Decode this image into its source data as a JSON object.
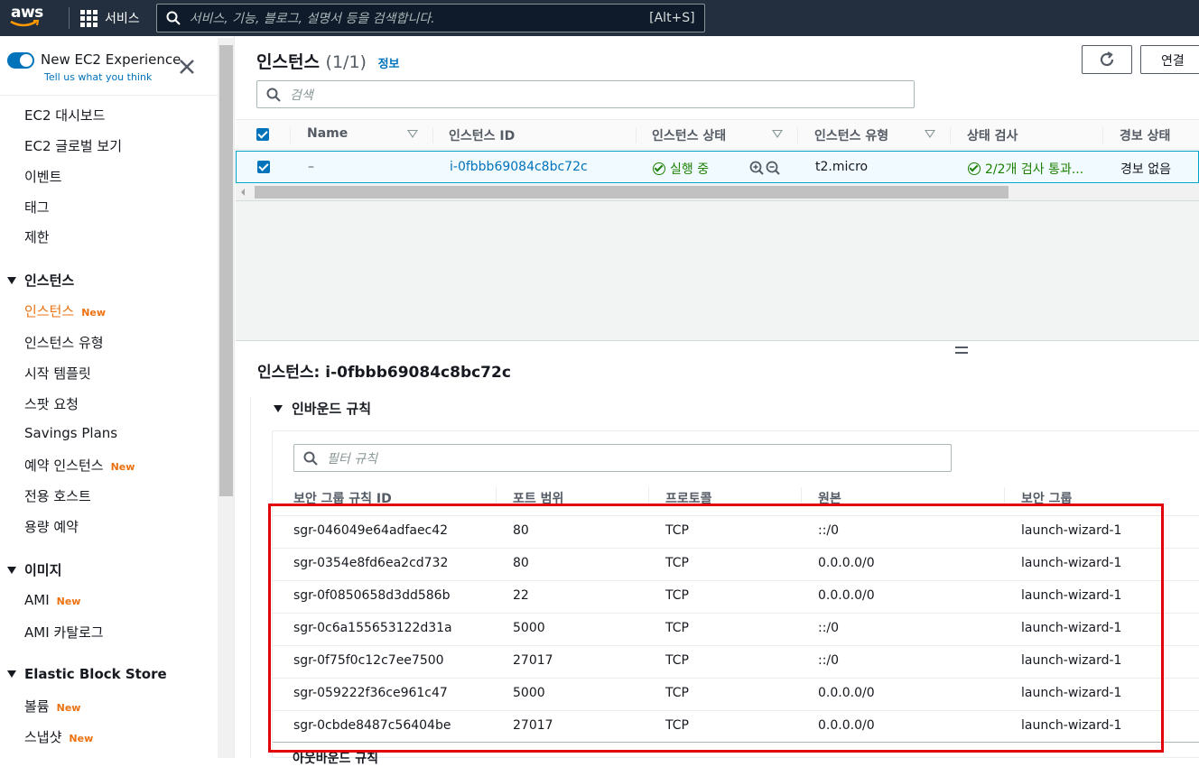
{
  "topbar": {
    "logo_text": "aws",
    "services_label": "서비스",
    "search_placeholder": "서비스, 기능, 블로그, 설명서 등을 검색합니다.",
    "search_shortcut": "[Alt+S]"
  },
  "sidebar": {
    "experience_title": "New EC2 Experience",
    "experience_sub": "Tell us what you think",
    "items": [
      {
        "label": "EC2 대시보드"
      },
      {
        "label": "EC2 글로벌 보기"
      },
      {
        "label": "이벤트"
      },
      {
        "label": "태그"
      },
      {
        "label": "제한"
      }
    ],
    "section_instances": "인스턴스",
    "instances_items": [
      {
        "label": "인스턴스",
        "badge": "New"
      },
      {
        "label": "인스턴스 유형"
      },
      {
        "label": "시작 템플릿"
      },
      {
        "label": "스팟 요청"
      },
      {
        "label": "Savings Plans"
      },
      {
        "label": "예약 인스턴스",
        "badge": "New"
      },
      {
        "label": "전용 호스트"
      },
      {
        "label": "용량 예약"
      }
    ],
    "section_images": "이미지",
    "images_items": [
      {
        "label": "AMI",
        "badge": "New"
      },
      {
        "label": "AMI 카탈로그"
      }
    ],
    "section_ebs": "Elastic Block Store",
    "ebs_items": [
      {
        "label": "볼륨",
        "badge": "New"
      },
      {
        "label": "스냅샷",
        "badge": "New"
      }
    ]
  },
  "main": {
    "title": "인스턴스",
    "count": "(1/1)",
    "info": "정보",
    "connect_label": "연결",
    "search_placeholder": "검색",
    "columns": {
      "name": "Name",
      "instance_id": "인스턴스 ID",
      "state": "인스턴스 상태",
      "type": "인스턴스 유형",
      "status_check": "상태 검사",
      "alarm": "경보 상태"
    },
    "row": {
      "name": "–",
      "instance_id": "i-0fbbb69084c8bc72c",
      "state": "실행 중",
      "type": "t2.micro",
      "status_check": "2/2개 검사 통과...",
      "alarm": "경보 없음"
    }
  },
  "detail": {
    "title": "인스턴스: i-0fbbb69084c8bc72c",
    "inbound_title": "인바운드 규칙",
    "filter_placeholder": "필터 규칙",
    "columns": {
      "rule_id": "보안 그룹 규칙 ID",
      "port": "포트 범위",
      "protocol": "프로토콜",
      "source": "원본",
      "sg": "보안 그룹"
    },
    "rules": [
      {
        "id": "sgr-046049e64adfaec42",
        "port": "80",
        "protocol": "TCP",
        "source": "::/0",
        "sg": "launch-wizard-1"
      },
      {
        "id": "sgr-0354e8fd6ea2cd732",
        "port": "80",
        "protocol": "TCP",
        "source": "0.0.0.0/0",
        "sg": "launch-wizard-1"
      },
      {
        "id": "sgr-0f0850658d3dd586b",
        "port": "22",
        "protocol": "TCP",
        "source": "0.0.0.0/0",
        "sg": "launch-wizard-1"
      },
      {
        "id": "sgr-0c6a155653122d31a",
        "port": "5000",
        "protocol": "TCP",
        "source": "::/0",
        "sg": "launch-wizard-1"
      },
      {
        "id": "sgr-0f75f0c12c7ee7500",
        "port": "27017",
        "protocol": "TCP",
        "source": "::/0",
        "sg": "launch-wizard-1"
      },
      {
        "id": "sgr-059222f36ce961c47",
        "port": "5000",
        "protocol": "TCP",
        "source": "0.0.0.0/0",
        "sg": "launch-wizard-1"
      },
      {
        "id": "sgr-0cbde8487c56404be",
        "port": "27017",
        "protocol": "TCP",
        "source": "0.0.0.0/0",
        "sg": "launch-wizard-1"
      }
    ],
    "outbound_title": "아웃바운드 규칙"
  },
  "colors": {
    "topbar": "#232f3e",
    "accent": "#0073bb",
    "active_nav": "#ec7211",
    "success": "#1d8102",
    "highlight_box": "#e3000b"
  }
}
